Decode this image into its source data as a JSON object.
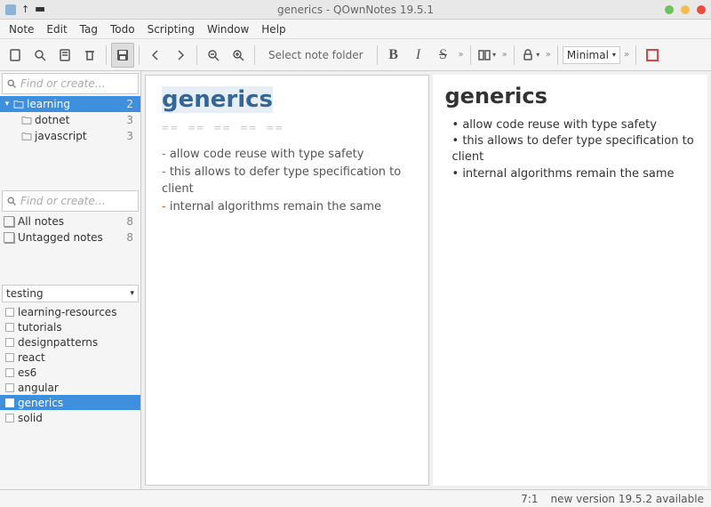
{
  "window": {
    "title": "generics - QOwnNotes 19.5.1"
  },
  "menu": {
    "items": [
      "Note",
      "Edit",
      "Tag",
      "Todo",
      "Scripting",
      "Window",
      "Help"
    ]
  },
  "toolbar": {
    "folder_label": "Select note folder",
    "style_select": "Minimal"
  },
  "sidebar": {
    "search1_placeholder": "Find or create…",
    "tree": {
      "root": {
        "label": "learning",
        "count": "2"
      },
      "children": [
        {
          "label": "dotnet",
          "count": "3"
        },
        {
          "label": "javascript",
          "count": "3"
        }
      ]
    },
    "search2_placeholder": "Find or create…",
    "filters": [
      {
        "label": "All notes",
        "count": "8"
      },
      {
        "label": "Untagged notes",
        "count": "8"
      }
    ],
    "tag_select": "testing",
    "notes": [
      "learning-resources",
      "tutorials",
      "designpatterns",
      "react",
      "es6",
      "angular",
      "generics",
      "solid"
    ],
    "selected_note": "generics"
  },
  "editor": {
    "title": "generics",
    "rule": "== == == == ==",
    "lines": [
      "allow code reuse with type safety",
      "this allows to defer type specification to client",
      "internal algorithms remain the same"
    ]
  },
  "preview": {
    "title": "generics",
    "items": [
      "allow code reuse with type safety",
      "this allows to defer type specification to client",
      "internal algorithms remain the same"
    ]
  },
  "status": {
    "cursor": "7:1",
    "message": "new version 19.5.2 available"
  }
}
